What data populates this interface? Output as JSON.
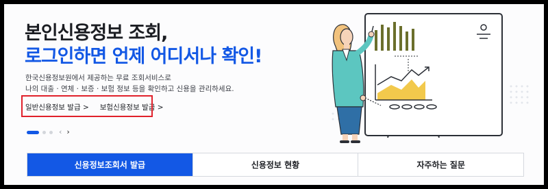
{
  "hero": {
    "title_line1": "본인신용정보 조회,",
    "title_line2": "로그인하면 언제 어디서나 확인!",
    "desc_line1": "한국신용정보원에서 제공하는 무료 조회서비스로",
    "desc_line2": "나의 대출 · 연체 · 보증 · 보험 정보 등을 확인하고 신용을 관리하세요."
  },
  "links": {
    "general_issue": "일반신용정보 발급 >",
    "insurance_issue": "보험신용정보 발급 >"
  },
  "carousel": {
    "prev_icon": "‹",
    "next_icon": "›",
    "current_slide": 1,
    "slide_count": 3
  },
  "tabs": [
    {
      "label": "신용정보조회서 발급",
      "active": true
    },
    {
      "label": "신용정보 현황",
      "active": false
    },
    {
      "label": "자주하는 질문",
      "active": false
    }
  ],
  "colors": {
    "accent": "#1358e5",
    "highlight_box": "#e0202a",
    "chart_bars": "#6b6f2c",
    "chart_area": "#f2c94c",
    "jacket": "#5cc6c0"
  },
  "illustration": {
    "icon": "woman-presenting-chart-illustration"
  }
}
